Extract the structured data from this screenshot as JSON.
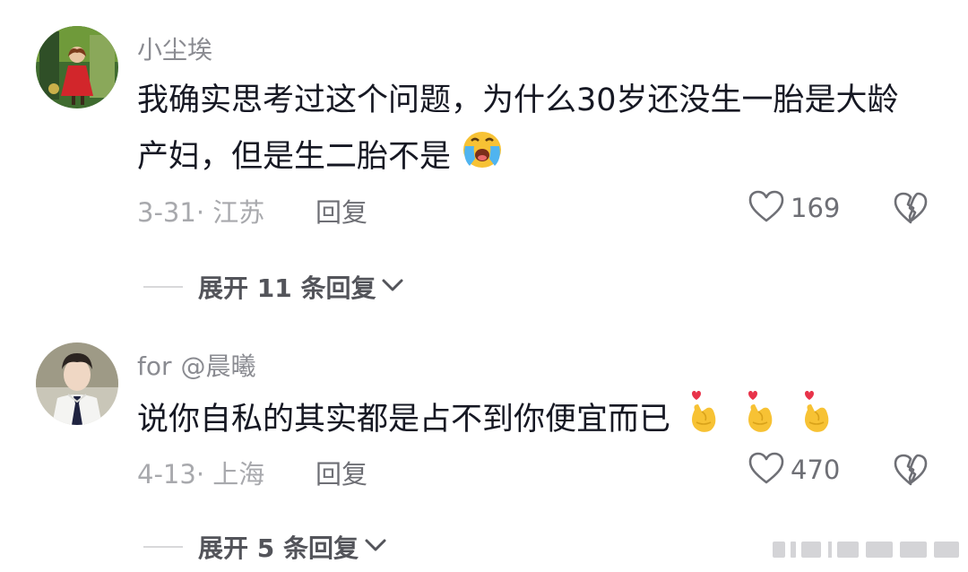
{
  "comments": [
    {
      "author": "小尘埃",
      "handle": "",
      "text": "我确实思考过这个问题，为什么30岁还没生一胎是大龄产妇，但是生二胎不是",
      "date_location": "3-31· 江苏",
      "reply_label": "回复",
      "likes": "169",
      "expand_label": "展开 11 条回复",
      "emoji_icons": [
        "loudly-crying-face-icon"
      ]
    },
    {
      "author": "for",
      "handle": "@晨曦",
      "text": "说你自私的其实都是占不到你便宜而已",
      "date_location": "4-13· 上海",
      "reply_label": "回复",
      "likes": "470",
      "expand_label": "展开 5 条回复",
      "emoji_icons": [
        "finger-heart-icon",
        "finger-heart-icon",
        "finger-heart-icon"
      ]
    }
  ],
  "colors": {
    "text": "#161823",
    "secondary": "#8a8b91",
    "muted": "#a8a9ad",
    "accent_emoji": "#f7c234"
  }
}
